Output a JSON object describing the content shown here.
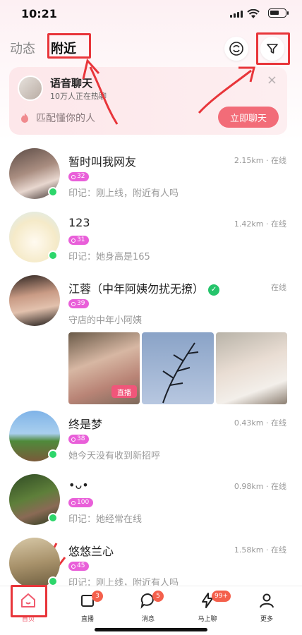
{
  "status_bar": {
    "time": "10:21"
  },
  "header": {
    "tabs": [
      {
        "label": "动态"
      },
      {
        "label": "附近"
      }
    ],
    "active_tab": "附近"
  },
  "voice_banner": {
    "title": "语音聊天",
    "subtitle": "10万人正在热聊",
    "match_text": "匹配懂你的人",
    "button_label": "立即聊天",
    "close": "×"
  },
  "users": [
    {
      "name": "暂时叫我网友",
      "distance": "2.15km · 在线",
      "badge": "32",
      "sign": "印记：刚上线，附近有人吗",
      "online": true
    },
    {
      "name": "123",
      "distance": "1.42km · 在线",
      "badge": "31",
      "sign": "印记：她身高是165",
      "online": true
    },
    {
      "name": "江蓉（中年阿姨勿扰无撩）",
      "distance": "在线",
      "badge": "39",
      "sign": "守店的中年小阿姨",
      "online": false,
      "live_tag": "直播"
    },
    {
      "name": "终是梦",
      "distance": "0.43km · 在线",
      "badge": "38",
      "sign": "她今天没有收到新招呼",
      "online": true
    },
    {
      "name": "•ᴗ•",
      "distance": "0.98km · 在线",
      "badge": "100",
      "sign": "印记：她经常在线",
      "online": true
    },
    {
      "name": "悠悠兰心",
      "distance": "1.58km · 在线",
      "badge": "45",
      "sign": "印记：刚上线，附近有人吗",
      "online": true
    }
  ],
  "tabbar": {
    "items": [
      {
        "label": "首页",
        "icon": "home-icon"
      },
      {
        "label": "直播",
        "icon": "live-icon",
        "count": "3"
      },
      {
        "label": "消息",
        "icon": "message-icon",
        "count": "5"
      },
      {
        "label": "马上聊",
        "icon": "lightning-icon",
        "count": "99+"
      },
      {
        "label": "更多",
        "icon": "person-icon"
      }
    ]
  },
  "colors": {
    "accent": "#f26c78",
    "online": "#2dd66b",
    "badge": "#e95fd9",
    "annotation": "#e8353a"
  }
}
